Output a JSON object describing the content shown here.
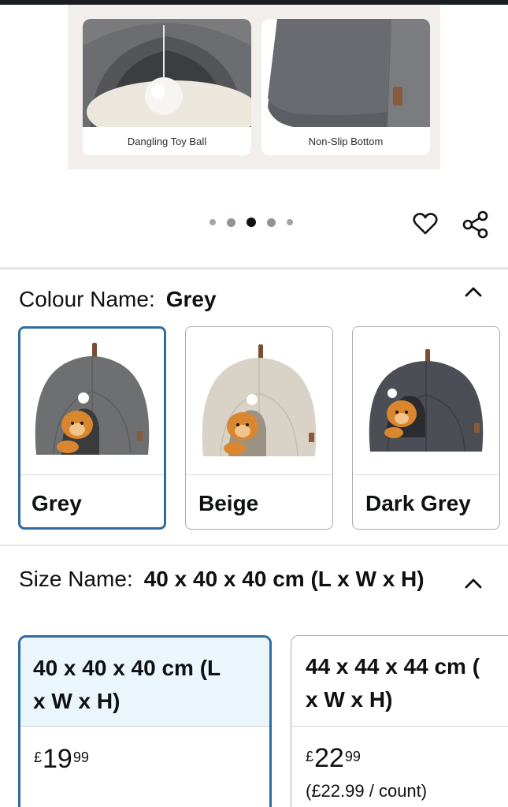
{
  "carousel": {
    "features": [
      {
        "caption": "Dangling Toy Ball"
      },
      {
        "caption": "Non-Slip Bottom"
      }
    ],
    "dots": {
      "count": 5,
      "active_index": 2
    }
  },
  "actions": {
    "wishlist_icon": "heart-icon",
    "share_icon": "share-icon"
  },
  "colour": {
    "label": "Colour Name:",
    "selected": "Grey",
    "options": [
      {
        "label": "Grey",
        "tent_color": "#6e6f71",
        "selected": true
      },
      {
        "label": "Beige",
        "tent_color": "#d9d2c7",
        "selected": false
      },
      {
        "label": "Dark Grey",
        "tent_color": "#4b4f55",
        "selected": false
      }
    ]
  },
  "size": {
    "label": "Size Name:",
    "selected": "40 x 40 x 40 cm (L x W x H)",
    "options": [
      {
        "line1": "40 x 40 x 40 cm (L",
        "line2": "x W x H)",
        "currency": "£",
        "whole": "19",
        "fraction": "99",
        "unit_price": "",
        "selected": true
      },
      {
        "line1": "44 x 44 x 44 cm (",
        "line2": "x W x H)",
        "currency": "£",
        "whole": "22",
        "fraction": "99",
        "unit_price": "(£22.99 / count)",
        "selected": false
      }
    ]
  },
  "colors": {
    "accent": "#2f6c9f",
    "selected_bg": "#eaf5fc",
    "divider": "#e3e6e6"
  }
}
